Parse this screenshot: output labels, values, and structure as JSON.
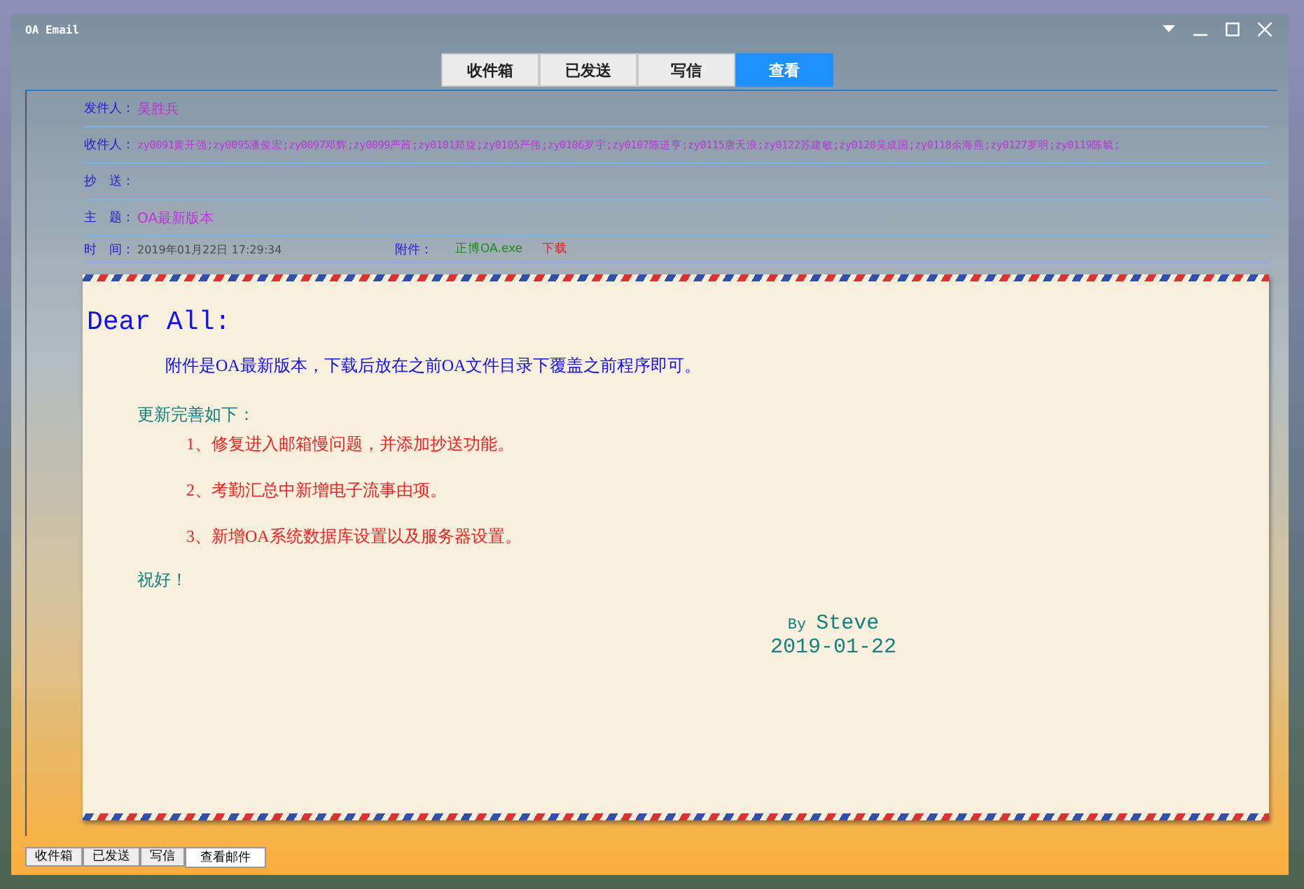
{
  "window": {
    "title": "OA Email"
  },
  "top_tabs": [
    {
      "label": "收件箱",
      "selected": false
    },
    {
      "label": "已发送",
      "selected": false
    },
    {
      "label": "写信",
      "selected": false
    },
    {
      "label": "查看",
      "selected": true
    }
  ],
  "header": {
    "sender": {
      "label": "发件人：",
      "value": "吴胜兵"
    },
    "recipients": {
      "label": "收件人：",
      "value": "zy0091黄开强;zy0095潘俊宏;zy0097邓辉;zy0099严茜;zy0101郑旋;zy0105严伟;zy0106罗宇;zy0107陈进亨;zy0115唐天浪;zy0122苏建敏;zy0120吴成国;zy0118余海燕;zy0127罗明;zy0119陈毓;"
    },
    "cc": {
      "label": "抄　送："
    },
    "subject": {
      "label": "主　题：",
      "value": "OA最新版本"
    },
    "time": {
      "label": "时　间：",
      "value": "2019年01月22日 17:29:34"
    },
    "attachment": {
      "label": "附件：",
      "filename": "正博OA.exe",
      "download": "下载"
    }
  },
  "letter": {
    "greeting": "Dear All:",
    "intro": "附件是OA最新版本，下载后放在之前OA文件目录下覆盖之前程序即可。",
    "list_heading": "更新完善如下：",
    "items": [
      "1、修复进入邮箱慢问题，并添加抄送功能。",
      "2、考勤汇总中新增电子流事由项。",
      "3、新增OA系统数据库设置以及服务器设置。"
    ],
    "closing": "祝好！",
    "signature_by": "By",
    "signature_name": "Steve",
    "date": "2019-01-22"
  },
  "bottom_tabs": [
    {
      "label": "收件箱",
      "selected": false
    },
    {
      "label": "已发送",
      "selected": false
    },
    {
      "label": "写信",
      "selected": false
    },
    {
      "label": "查看邮件",
      "selected": true
    }
  ]
}
